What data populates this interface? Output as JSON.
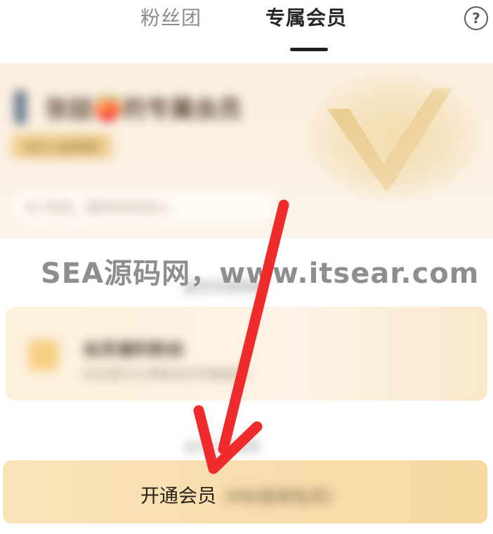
{
  "tabs": {
    "fans_label": "粉丝团",
    "member_label": "专属会员",
    "help_symbol": "?"
  },
  "member_card": {
    "title": "张喆🍑的专属会员",
    "badge": "AR入会特权",
    "intro_text": "Hi 欢迎，期待你的加入"
  },
  "watermark": "SEA源码网，www.itsear.com",
  "section1_title": "会员专享特权",
  "privilege": {
    "title": "会员福利粉丝",
    "desc": "在这里可以领取会员专属福利"
  },
  "section2_title": "会员订阅说明",
  "cta": {
    "label": "开通会员",
    "sub": "(¥9/连续包月)"
  },
  "colors": {
    "arrow": "#ef2b2b",
    "cta_bg": "#f8dfaf",
    "card_bg": "#fbeedd"
  }
}
